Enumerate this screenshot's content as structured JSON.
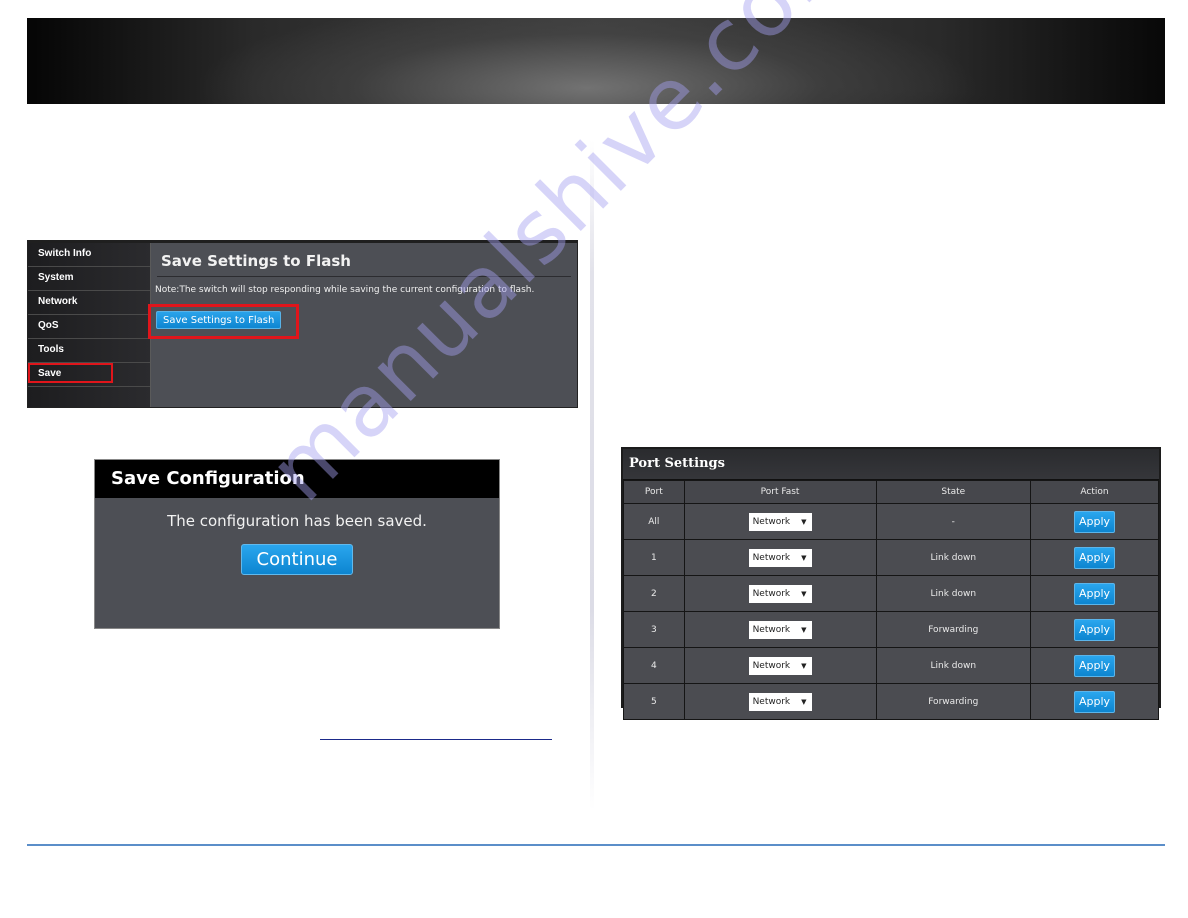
{
  "watermark": "manualshive.com",
  "save_flash_screen": {
    "sidebar": [
      {
        "label": "Switch Info",
        "highlighted": false
      },
      {
        "label": "System",
        "highlighted": false
      },
      {
        "label": "Network",
        "highlighted": false
      },
      {
        "label": "QoS",
        "highlighted": false
      },
      {
        "label": "Tools",
        "highlighted": false
      },
      {
        "label": "Save",
        "highlighted": true
      }
    ],
    "title": "Save Settings to Flash",
    "note": "Note:The switch will stop responding while saving the current configuration to flash.",
    "button_label": "Save Settings to Flash",
    "highlight_color": "#e0151b"
  },
  "save_config_dialog": {
    "title": "Save Configuration",
    "message": "The configuration has been saved.",
    "button_label": "Continue"
  },
  "port_settings": {
    "title": "Port Settings",
    "columns": [
      "Port",
      "Port Fast",
      "State",
      "Action"
    ],
    "rows": [
      {
        "port": "All",
        "port_fast": "Network",
        "state": "-",
        "action": "Apply"
      },
      {
        "port": "1",
        "port_fast": "Network",
        "state": "Link down",
        "action": "Apply"
      },
      {
        "port": "2",
        "port_fast": "Network",
        "state": "Link down",
        "action": "Apply"
      },
      {
        "port": "3",
        "port_fast": "Network",
        "state": "Forwarding",
        "action": "Apply"
      },
      {
        "port": "4",
        "port_fast": "Network",
        "state": "Link down",
        "action": "Apply"
      },
      {
        "port": "5",
        "port_fast": "Network",
        "state": "Forwarding",
        "action": "Apply"
      }
    ],
    "dropdown_arrow": "▼",
    "accent_color": "#0e86d1"
  },
  "colors": {
    "footer_rule": "#5b8ec9",
    "link_underline": "#1b2a8a"
  }
}
